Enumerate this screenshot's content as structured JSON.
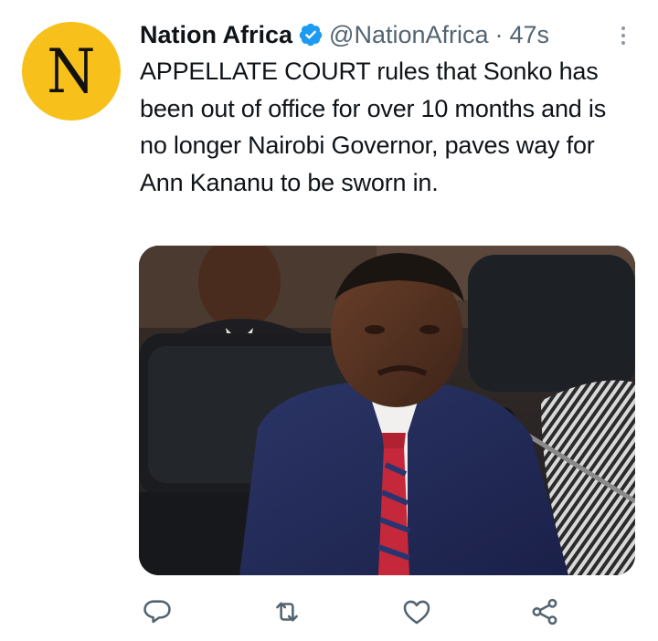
{
  "author": {
    "avatar_letter": "N",
    "display_name": "Nation Africa",
    "handle": "@NationAfrica",
    "separator": "·",
    "timestamp": "47s",
    "verified": true,
    "avatar_color": "#f7c01a"
  },
  "tweet": {
    "text": "APPELLATE COURT rules that Sonko has been out of office for over 10 months and is no longer Nairobi Governor, paves way for Ann Kananu to be sworn in."
  },
  "actions": {
    "icons": [
      "reply-icon",
      "retweet-icon",
      "like-icon",
      "share-icon"
    ]
  },
  "colors": {
    "verified_blue": "#1d9bf0",
    "secondary_text": "#536471",
    "icon_gray": "#536471"
  }
}
